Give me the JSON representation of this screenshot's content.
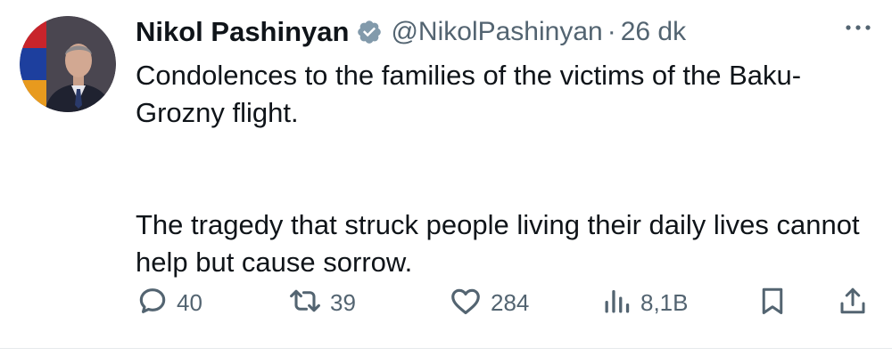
{
  "tweet": {
    "author": {
      "display_name": "Nikol Pashinyan",
      "handle": "@NikolPashinyan",
      "verified": true
    },
    "separator": "·",
    "time": "26 dk",
    "paragraphs": [
      "Condolences to the families of the victims of the Baku-Grozny flight.",
      "The tragedy that struck people living their daily lives cannot help but cause sorrow."
    ],
    "actions": {
      "replies": "40",
      "reposts": "39",
      "likes": "284",
      "views": "8,1B"
    }
  },
  "icons": {
    "verified": "verified-badge-icon",
    "more": "more-horizontal-icon",
    "reply": "reply-bubble-icon",
    "repost": "repost-icon",
    "like": "heart-icon",
    "views": "bar-chart-icon",
    "bookmark": "bookmark-icon",
    "share": "share-upload-icon"
  },
  "colors": {
    "text_primary": "#0f1419",
    "text_secondary": "#536471",
    "icon_gray": "#536471",
    "verified_gray": "#829aab"
  }
}
